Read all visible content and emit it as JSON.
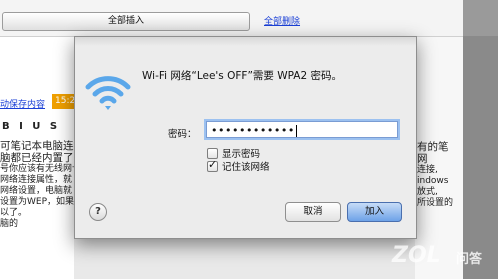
{
  "background": {
    "insert_all_button": "全部插入",
    "delete_all_link": "全部删除",
    "autosave_link": "动保存内容",
    "time_badge": "15:23",
    "format_toolbar": "B I U S",
    "left_text_lines": [
      "可笔记本电脑连接",
      "脑都已经内置了无",
      "号你应该有无线网卡",
      "网络连接属性，就",
      "网络设置，电脑就",
      "设置为WEP，如果",
      "以了。",
      "",
      "脑的"
    ],
    "right_text_lines": [
      "有的笔",
      "网",
      "连接,",
      "indows",
      "放式,",
      "所设置的",
      ""
    ],
    "watermark_logo": "ZOL",
    "watermark_text": "问答"
  },
  "dialog": {
    "title": "Wi-Fi 网络“Lee's OFF”需要 WPA2 密码。",
    "password_label": "密码：",
    "password_value": "••••••••••••",
    "show_password_label": "显示密码",
    "show_password_checked": false,
    "remember_network_label": "记住该网络",
    "remember_network_checked": true,
    "help_label": "?",
    "cancel_label": "取消",
    "join_label": "加入",
    "icon": "wifi-icon"
  },
  "colors": {
    "accent_blue": "#6ea2e8",
    "link_blue": "#1a3fd6",
    "time_badge": "#f0a000"
  }
}
